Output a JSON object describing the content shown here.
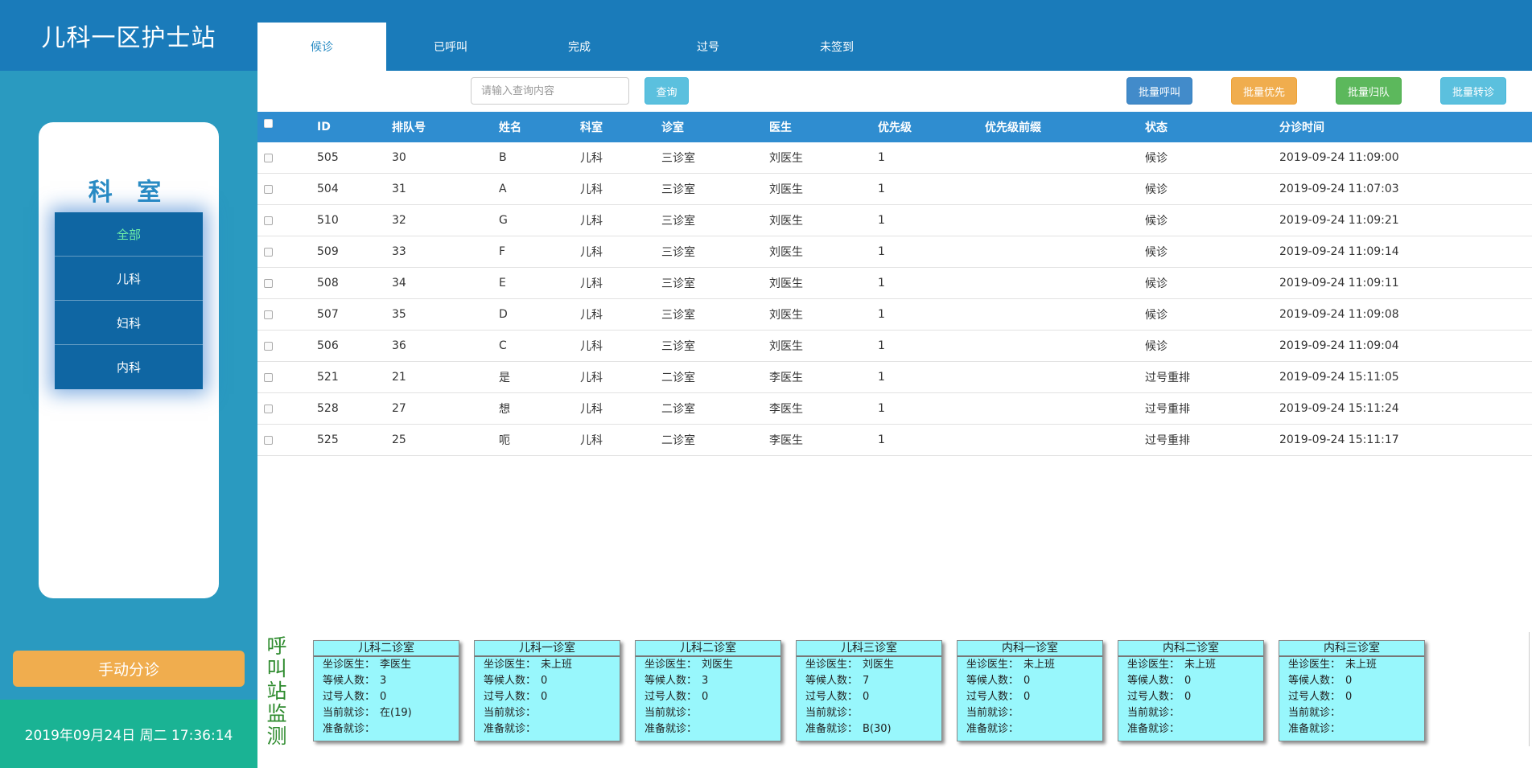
{
  "sidebar": {
    "title": "儿科一区护士站",
    "dept_title": "科 室",
    "departments": [
      "全部",
      "儿科",
      "妇科",
      "内科"
    ],
    "manual_button": "手动分诊",
    "clock": "2019年09月24日 周二 17:36:14"
  },
  "tabs": [
    "候诊",
    "已呼叫",
    "完成",
    "过号",
    "未签到"
  ],
  "toolbar": {
    "search_placeholder": "请输入查询内容",
    "query": "查询",
    "batch_call": "批量呼叫",
    "batch_priority": "批量优先",
    "batch_return": "批量归队",
    "batch_transfer": "批量转诊"
  },
  "table": {
    "headers": [
      "ID",
      "排队号",
      "姓名",
      "科室",
      "诊室",
      "医生",
      "优先级",
      "优先级前缀",
      "状态",
      "分诊时间"
    ],
    "rows": [
      [
        "505",
        "30",
        "B",
        "儿科",
        "三诊室",
        "刘医生",
        "1",
        "",
        "候诊",
        "2019-09-24 11:09:00"
      ],
      [
        "504",
        "31",
        "A",
        "儿科",
        "三诊室",
        "刘医生",
        "1",
        "",
        "候诊",
        "2019-09-24 11:07:03"
      ],
      [
        "510",
        "32",
        "G",
        "儿科",
        "三诊室",
        "刘医生",
        "1",
        "",
        "候诊",
        "2019-09-24 11:09:21"
      ],
      [
        "509",
        "33",
        "F",
        "儿科",
        "三诊室",
        "刘医生",
        "1",
        "",
        "候诊",
        "2019-09-24 11:09:14"
      ],
      [
        "508",
        "34",
        "E",
        "儿科",
        "三诊室",
        "刘医生",
        "1",
        "",
        "候诊",
        "2019-09-24 11:09:11"
      ],
      [
        "507",
        "35",
        "D",
        "儿科",
        "三诊室",
        "刘医生",
        "1",
        "",
        "候诊",
        "2019-09-24 11:09:08"
      ],
      [
        "506",
        "36",
        "C",
        "儿科",
        "三诊室",
        "刘医生",
        "1",
        "",
        "候诊",
        "2019-09-24 11:09:04"
      ],
      [
        "521",
        "21",
        "是",
        "儿科",
        "二诊室",
        "李医生",
        "1",
        "",
        "过号重排",
        "2019-09-24 15:11:05"
      ],
      [
        "528",
        "27",
        "想",
        "儿科",
        "二诊室",
        "李医生",
        "1",
        "",
        "过号重排",
        "2019-09-24 15:11:24"
      ],
      [
        "525",
        "25",
        "呃",
        "儿科",
        "二诊室",
        "李医生",
        "1",
        "",
        "过号重排",
        "2019-09-24 15:11:17"
      ]
    ]
  },
  "monitor": {
    "label": [
      "呼",
      "叫",
      "站",
      "监",
      "测"
    ],
    "field_labels": {
      "doctor": "坐诊医生：",
      "waiting": "等候人数：",
      "passed": "过号人数：",
      "current": "当前就诊：",
      "next": "准备就诊："
    },
    "rooms": [
      {
        "name": "儿科二诊室",
        "doctor": "李医生",
        "waiting": "3",
        "passed": "0",
        "current": "在(19)",
        "next": ""
      },
      {
        "name": "儿科一诊室",
        "doctor": "未上班",
        "waiting": "0",
        "passed": "0",
        "current": "",
        "next": ""
      },
      {
        "name": "儿科二诊室",
        "doctor": "刘医生",
        "waiting": "3",
        "passed": "0",
        "current": "",
        "next": ""
      },
      {
        "name": "儿科三诊室",
        "doctor": "刘医生",
        "waiting": "7",
        "passed": "0",
        "current": "",
        "next": "B(30)"
      },
      {
        "name": "内科一诊室",
        "doctor": "未上班",
        "waiting": "0",
        "passed": "0",
        "current": "",
        "next": ""
      },
      {
        "name": "内科二诊室",
        "doctor": "未上班",
        "waiting": "0",
        "passed": "0",
        "current": "",
        "next": ""
      },
      {
        "name": "内科三诊室",
        "doctor": "未上班",
        "waiting": "0",
        "passed": "0",
        "current": "",
        "next": ""
      }
    ]
  }
}
